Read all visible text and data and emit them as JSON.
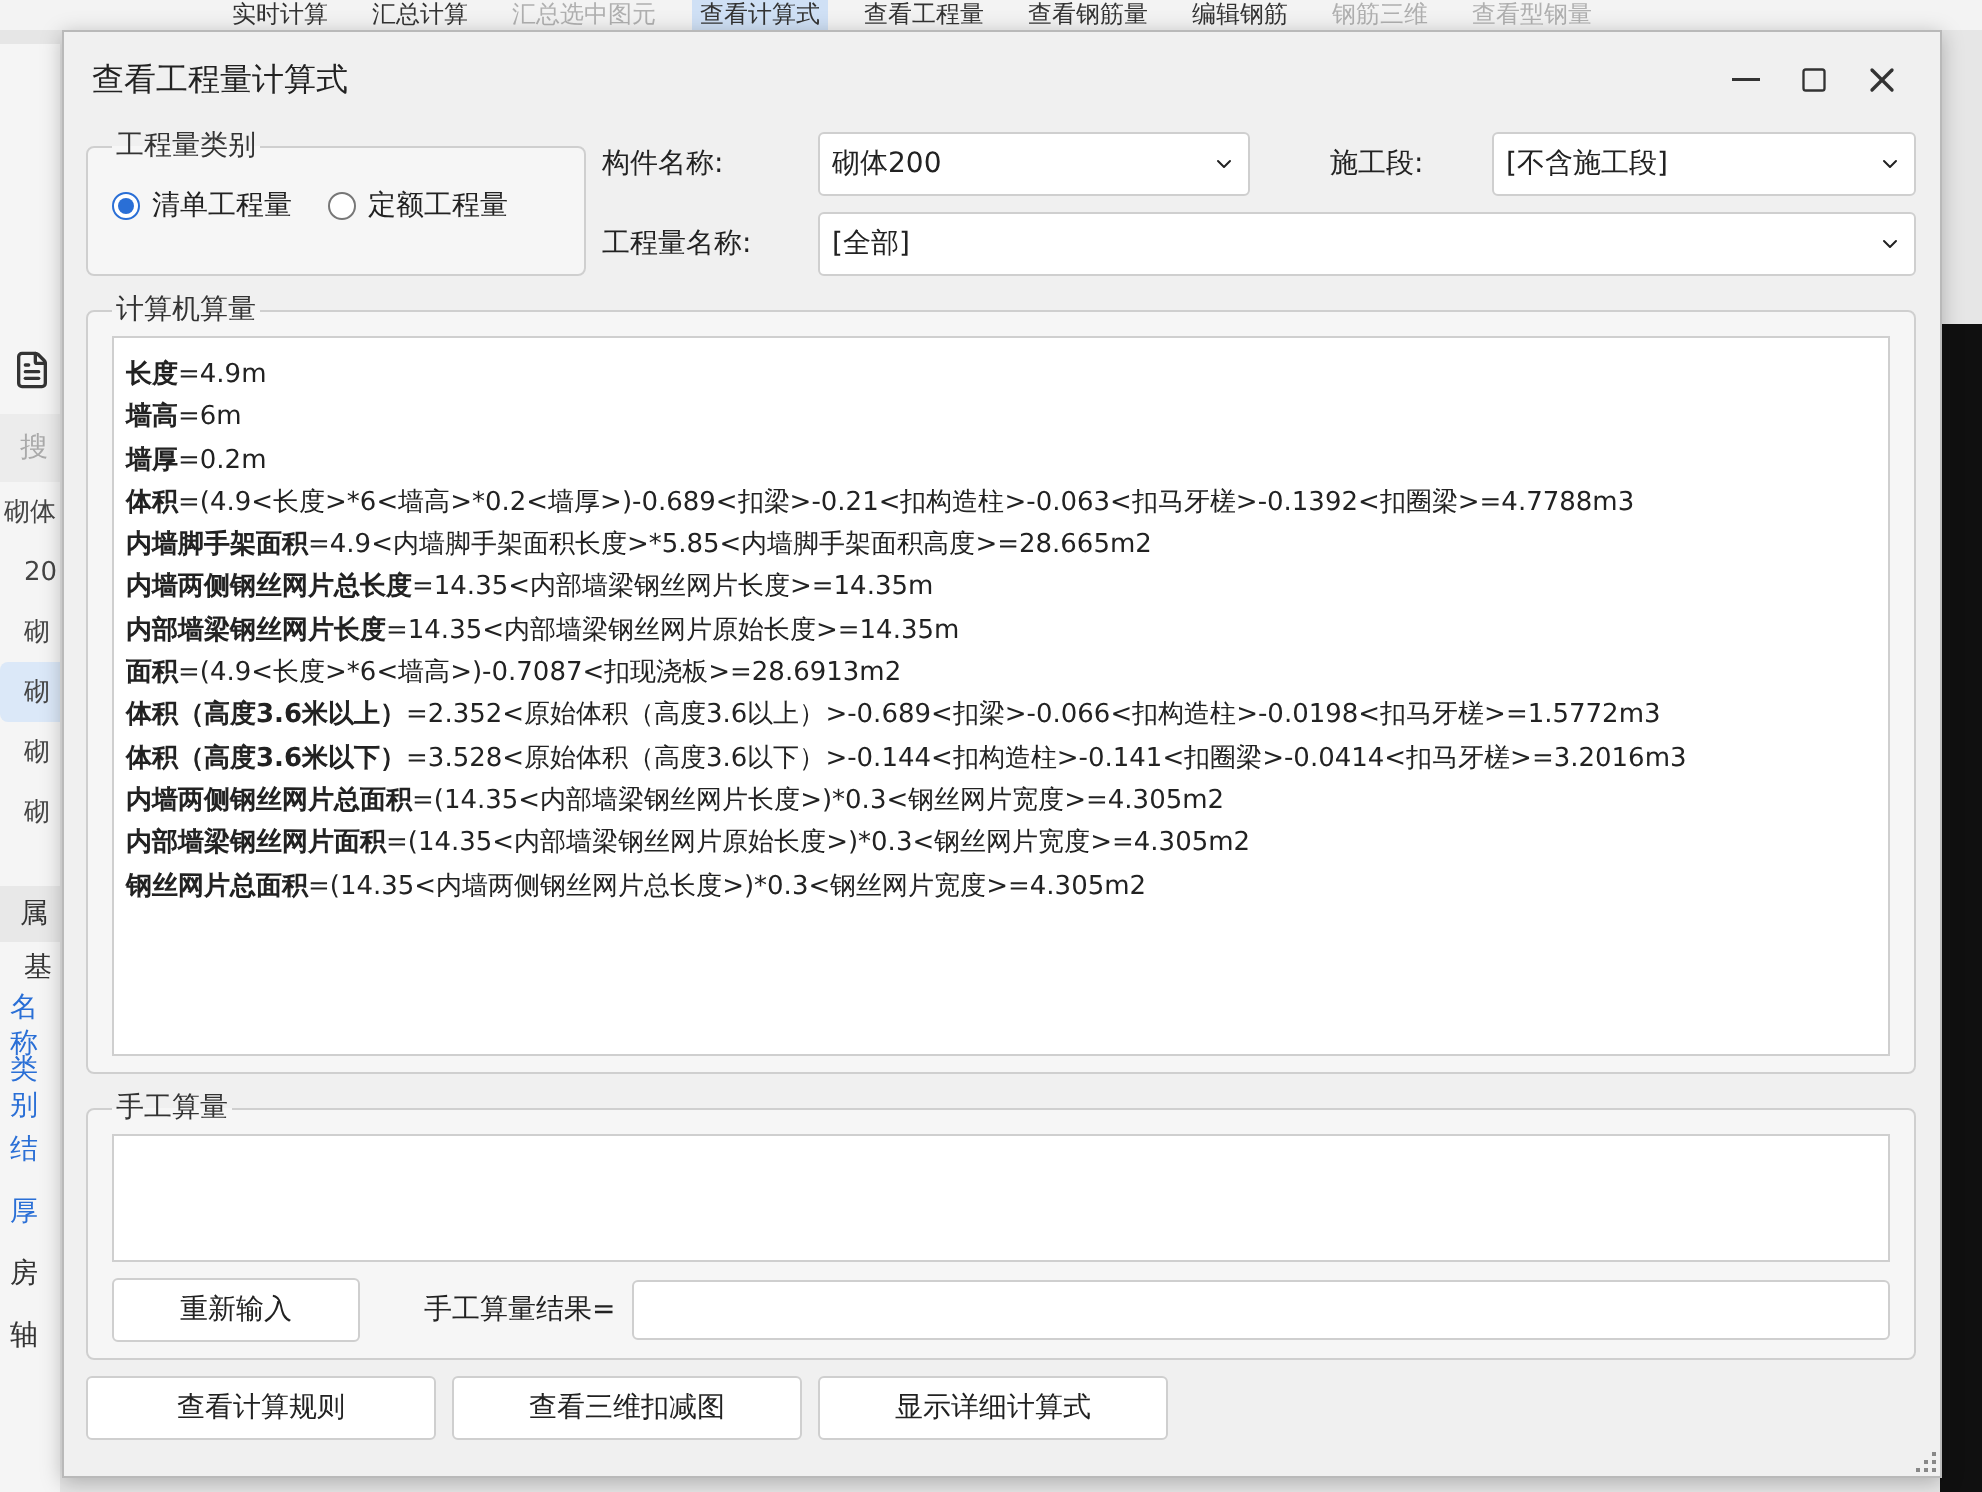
{
  "background": {
    "toolbar": [
      {
        "label": "实时计算",
        "selected": false,
        "disabled": false
      },
      {
        "label": "汇总计算",
        "selected": false,
        "disabled": false
      },
      {
        "label": "汇总选中图元",
        "selected": false,
        "disabled": true
      },
      {
        "label": "查看计算式",
        "selected": true,
        "disabled": false
      },
      {
        "label": "查看工程量",
        "selected": false,
        "disabled": false
      },
      {
        "label": "查看钢筋量",
        "selected": false,
        "disabled": false
      },
      {
        "label": "编辑钢筋",
        "selected": false,
        "disabled": false
      },
      {
        "label": "钢筋三维",
        "selected": false,
        "disabled": true
      },
      {
        "label": "查看型钢量",
        "selected": false,
        "disabled": true
      }
    ],
    "search_placeholder": "搜",
    "tree_items": [
      {
        "label": "砌体",
        "selected": false
      },
      {
        "label": "20",
        "selected": false
      },
      {
        "label": "砌",
        "selected": false
      },
      {
        "label": "砌",
        "selected": true
      },
      {
        "label": "砌",
        "selected": false
      },
      {
        "label": "砌",
        "selected": false
      }
    ],
    "properties_header": "属",
    "properties_group": "基",
    "properties": [
      "名称",
      "类别",
      "结",
      "厚",
      "房",
      "轴"
    ]
  },
  "dialog": {
    "title": "查看工程量计算式",
    "quantity_type": {
      "legend": "工程量类别",
      "options": [
        {
          "label": "清单工程量",
          "selected": true
        },
        {
          "label": "定额工程量",
          "selected": false
        }
      ]
    },
    "component_name": {
      "label": "构件名称:",
      "value": "砌体200"
    },
    "construction_stage": {
      "label": "施工段:",
      "value": "[不含施工段]"
    },
    "quantity_name": {
      "label": "工程量名称:",
      "value": "[全部]"
    },
    "computer": {
      "legend": "计算机算量",
      "lines": [
        {
          "term": "长度",
          "expr": "=4.9m"
        },
        {
          "term": "墙高",
          "expr": "=6m"
        },
        {
          "term": "墙厚",
          "expr": "=0.2m"
        },
        {
          "term": "体积",
          "expr": "=(4.9<长度>*6<墙高>*0.2<墙厚>)-0.689<扣梁>-0.21<扣构造柱>-0.063<扣马牙槎>-0.1392<扣圈梁>=4.7788m3"
        },
        {
          "term": "内墙脚手架面积",
          "expr": "=4.9<内墙脚手架面积长度>*5.85<内墙脚手架面积高度>=28.665m2"
        },
        {
          "term": "内墙两侧钢丝网片总长度",
          "expr": "=14.35<内部墙梁钢丝网片长度>=14.35m"
        },
        {
          "term": "内部墙梁钢丝网片长度",
          "expr": "=14.35<内部墙梁钢丝网片原始长度>=14.35m"
        },
        {
          "term": "面积",
          "expr": "=(4.9<长度>*6<墙高>)-0.7087<扣现浇板>=28.6913m2"
        },
        {
          "term": "体积（高度3.6米以上）",
          "expr": "=2.352<原始体积（高度3.6以上）>-0.689<扣梁>-0.066<扣构造柱>-0.0198<扣马牙槎>=1.5772m3"
        },
        {
          "term": "体积（高度3.6米以下）",
          "expr": "=3.528<原始体积（高度3.6以下）>-0.144<扣构造柱>-0.141<扣圈梁>-0.0414<扣马牙槎>=3.2016m3"
        },
        {
          "term": "内墙两侧钢丝网片总面积",
          "expr": "=(14.35<内部墙梁钢丝网片长度>)*0.3<钢丝网片宽度>=4.305m2"
        },
        {
          "term": "内部墙梁钢丝网片面积",
          "expr": "=(14.35<内部墙梁钢丝网片原始长度>)*0.3<钢丝网片宽度>=4.305m2"
        },
        {
          "term": "钢丝网片总面积",
          "expr": "=(14.35<内墙两侧钢丝网片总长度>)*0.3<钢丝网片宽度>=4.305m2"
        }
      ]
    },
    "manual": {
      "legend": "手工算量",
      "reenter_button": "重新输入",
      "result_label": "手工算量结果="
    },
    "buttons": [
      "查看计算规则",
      "查看三维扣减图",
      "显示详细计算式"
    ]
  }
}
